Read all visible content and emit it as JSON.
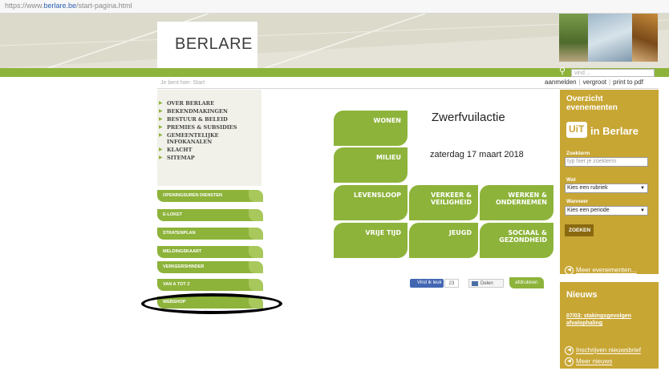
{
  "browser": {
    "url_prefix": "https://www.",
    "url_host": "berlare.be",
    "url_path": "/start-pagina.html"
  },
  "header": {
    "logo_text": "BERLARE",
    "search_placeholder": "vind ...",
    "breadcrumb": "Je bent hier: Start",
    "links": [
      "aanmelden",
      "vergroot",
      "print to pdf"
    ],
    "colors": {
      "accent": "#8db33a",
      "panel": "#c8a634"
    }
  },
  "left_menu": {
    "items": [
      "OVER BERLARE",
      "BEKENDMAKINGEN",
      "BESTUUR & BELEID",
      "PREMIES & SUBSIDIES",
      "GEMEENTELIJKE",
      "INFOKANALEN",
      "KLACHT",
      "SITEMAP"
    ],
    "buttons": [
      "OPENINGSUREN DIENSTEN",
      "E-LOKET",
      "STRATENPLAN",
      "MELDINGSKAART",
      "VERKEERSHINDER",
      "VAN A TOT Z",
      "WEBSHOP"
    ]
  },
  "tiles": [
    {
      "label": "WONEN"
    },
    {
      "label": "MILIEU"
    },
    {
      "label": "LEVENSLOOP"
    },
    {
      "label": "VERKEER & VEILIGHEID"
    },
    {
      "label": "WERKEN & ONDERNEMEN"
    },
    {
      "label": "VRIJE TIJD"
    },
    {
      "label": "JEUGD"
    },
    {
      "label": "SOCIAAL & GEZONDHEID"
    }
  ],
  "feature": {
    "title": "Zwerfvuilactie",
    "date": "zaterdag 17 maart 2018"
  },
  "social": {
    "fb_label": "Vind ik leuk",
    "fb_count": "23",
    "share_label": "Delen",
    "print_label": "afdrukken"
  },
  "events_panel": {
    "title_line1": "Overzicht",
    "title_line2": "evenementen",
    "uit_logo": "UiT",
    "uit_text": "in Berlare",
    "zoekterm_label": "Zoekterm",
    "zoekterm_placeholder": "typ hier je zoekterm",
    "wat_label": "Wat",
    "wat_value": "Kies een rubriek",
    "wanneer_label": "Wanneer",
    "wanneer_value": "Kies een periode",
    "search_button": "ZOEKEN",
    "more_link": "Meer evenementen..."
  },
  "news_panel": {
    "title": "Nieuws",
    "item": "07/03: stakingsgevolgen afvalophaling",
    "subscribe_link": "Inschrijven nieuwsbrief",
    "more_link": "Meer nieuws"
  }
}
